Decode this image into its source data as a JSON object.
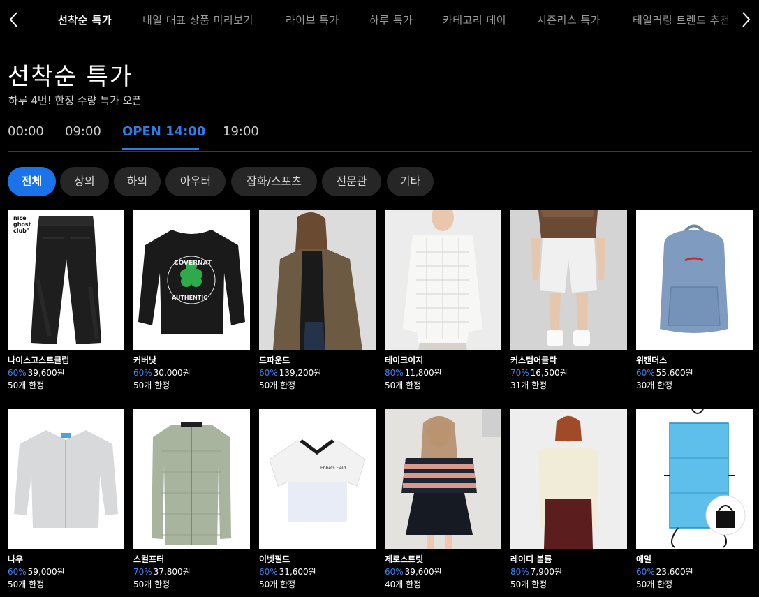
{
  "nav": {
    "tabs": [
      "선착순 특가",
      "내일 대표 상품 미리보기",
      "라이브 특가",
      "하루 특가",
      "카테고리 데이",
      "시즌리스 특가",
      "테일러링 트렌드 추천"
    ],
    "active_index": 0
  },
  "page": {
    "title": "선착순 특가",
    "subtitle": "하루 4번! 한정 수량 특가 오픈"
  },
  "times": [
    "00:00",
    "09:00",
    "OPEN 14:00",
    "19:00"
  ],
  "filters": [
    "전체",
    "상의",
    "하의",
    "아우터",
    "잡화/스포츠",
    "전문관",
    "기타"
  ],
  "colors": {
    "accent": "#1a73e8",
    "discount": "#3b82f6",
    "background": "#000000"
  },
  "products": [
    {
      "brand": "나이스고스트클럽",
      "discount": "60%",
      "price": "39,600원",
      "limit": "50개 한정",
      "image": "black-wide-jeans",
      "logo_text": "nice ghost club"
    },
    {
      "brand": "커버낫",
      "discount": "60%",
      "price": "30,000원",
      "limit": "50개 한정",
      "image": "black-sweatshirt",
      "logo_text": "COVERNAT AUTHENTIC"
    },
    {
      "brand": "드파운드",
      "discount": "60%",
      "price": "139,200원",
      "limit": "50개 한정",
      "image": "model-brown-coat"
    },
    {
      "brand": "테이크이지",
      "discount": "80%",
      "price": "11,800원",
      "limit": "50개 한정",
      "image": "model-white-knit"
    },
    {
      "brand": "커스텀어클락",
      "discount": "70%",
      "price": "16,500원",
      "limit": "31개 한정",
      "image": "model-white-shorts"
    },
    {
      "brand": "위캔더스",
      "discount": "60%",
      "price": "55,600원",
      "limit": "30개 한정",
      "image": "denim-backpack"
    },
    {
      "brand": "나우",
      "discount": "60%",
      "price": "59,000원",
      "limit": "50개 한정",
      "image": "grey-fleece-cardigan"
    },
    {
      "brand": "스컬프터",
      "discount": "70%",
      "price": "37,800원",
      "limit": "50개 한정",
      "image": "green-knit-cardigan"
    },
    {
      "brand": "이벳필드",
      "discount": "60%",
      "price": "31,600원",
      "limit": "50개 한정",
      "image": "white-jersey-tee"
    },
    {
      "brand": "제로스트릿",
      "discount": "60%",
      "price": "39,600원",
      "limit": "40개 한정",
      "image": "model-stripe-sweater"
    },
    {
      "brand": "레이디 볼륨",
      "discount": "80%",
      "price": "7,900원",
      "limit": "50개 한정",
      "image": "model-cream-top"
    },
    {
      "brand": "에일",
      "discount": "60%",
      "price": "23,600원",
      "limit": "50개 한정",
      "image": "blue-foldable-bag"
    }
  ]
}
